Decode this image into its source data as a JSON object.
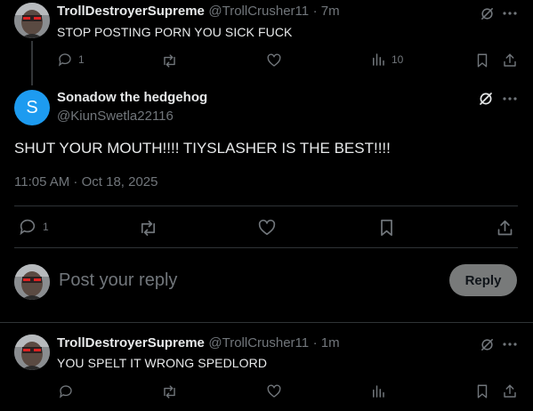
{
  "tweet1": {
    "display_name": "TrollDestroyerSupreme",
    "handle": "@TrollCrusher11",
    "time": "· 7m",
    "text": "STOP POSTING PORN YOU SICK FUCK",
    "reply_count": "1",
    "views_count": "10"
  },
  "main": {
    "display_name": "Sonadow the hedgehog",
    "handle": "@KiunSwetla22116",
    "avatar_letter": "S",
    "avatar_color": "#1d9bf0",
    "text": "SHUT YOUR MOUTH!!!! TIYSLASHER IS THE BEST!!!!",
    "timestamp": "11:05 AM · Oct 18, 2025",
    "reply_count": "1"
  },
  "composer": {
    "placeholder": "Post your reply",
    "reply_label": "Reply"
  },
  "tweet2": {
    "display_name": "TrollDestroyerSupreme",
    "handle": "@TrollCrusher11",
    "time": "· 1m",
    "text": "YOU SPELT IT WRONG SPEDLORD"
  },
  "colors": {
    "background": "#000000",
    "text": "#e7e9ea",
    "muted": "#71767b",
    "divider": "#2f3336",
    "accent": "#1d9bf0"
  },
  "icons": [
    "reply-icon",
    "repost-icon",
    "like-icon",
    "views-icon",
    "bookmark-icon",
    "share-icon",
    "grok-icon",
    "more-icon"
  ]
}
